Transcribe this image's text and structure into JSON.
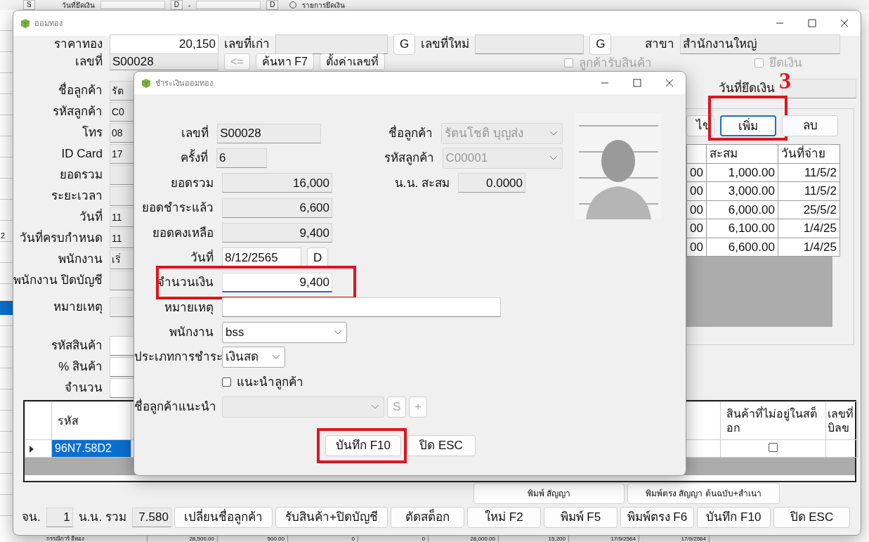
{
  "background_window": {
    "top_bar": {
      "s_button": "S",
      "date_label": "วันที่ยึดเงิน",
      "d_buttons": [
        "D",
        "D"
      ],
      "separator": "-",
      "radio": {
        "label": "รายการยึดเงิน",
        "selected": false
      }
    },
    "left_fragment": "2",
    "bottom_row": [
      "กรรณิการ์ อีทอง",
      "28,500.00",
      "500.00",
      "0",
      "0",
      "28,000.00",
      "15,200",
      "17/9/2564",
      "17/9/2564"
    ]
  },
  "main_window": {
    "title": "ออมทอง",
    "top_row": {
      "gold_price": {
        "label": "ราคาทอง",
        "value": "20,150"
      },
      "old_number": {
        "label": "เลขที่เก่า",
        "button": "G"
      },
      "new_number": {
        "label": "เลขที่ใหม่",
        "button": "G"
      },
      "branch": {
        "label": "สาขา",
        "value": "สำนักงานใหญ่"
      }
    },
    "number_row": {
      "label": "เลขที่",
      "value": "S00028",
      "buttons": [
        {
          "label": "<=",
          "disabled": true
        },
        {
          "label": "ค้นหา F7",
          "disabled": false
        },
        {
          "label": "ตั้งค่าเลขที่",
          "disabled": false
        }
      ],
      "checkboxes": [
        {
          "label": "ลูกค้ารับสินค้า",
          "checked": false,
          "disabled": true
        },
        {
          "label": "ยึดเงิน",
          "checked": false,
          "disabled": true
        }
      ]
    },
    "form_fields": [
      {
        "label": "ชื่อลูกค้า",
        "value": "รัต"
      },
      {
        "label": "รหัสลูกค้า",
        "value": "C0"
      },
      {
        "label": "โทร",
        "value": "08"
      },
      {
        "label": "ID Card",
        "value": "17"
      },
      {
        "label": "ยอดรวม"
      },
      {
        "label": "ระยะเวลา"
      },
      {
        "label": "วันที่",
        "value": "11"
      },
      {
        "label": "วันที่ครบกำหนด",
        "value": "11"
      },
      {
        "label": "พนักงาน",
        "value": "เริ่"
      },
      {
        "label": "พนักงาน ปิดบัญชี"
      },
      {
        "label": "หมายเหตุ"
      }
    ],
    "product_fields": [
      {
        "label": "รหัสสินค้า"
      },
      {
        "label": "% สินค้า"
      },
      {
        "label": "จำนวน"
      }
    ],
    "seize_date": {
      "label": "วันที่ยึดเงิน"
    },
    "step_number": "3",
    "payment_buttons": [
      {
        "label": "ไข",
        "focused": false,
        "highlighted": false
      },
      {
        "label": "เพิ่ม",
        "focused": true,
        "highlighted": true
      },
      {
        "label": "ลบ",
        "focused": false,
        "highlighted": false
      }
    ],
    "payment_table": {
      "columns": [
        "สะสม",
        "วันที่จ่าย"
      ],
      "rows": [
        {
          "column_1": "00",
          "accumulated": "1,000.00",
          "paid_date": "11/5/2"
        },
        {
          "column_1": "00",
          "accumulated": "3,000.00",
          "paid_date": "11/5/2"
        },
        {
          "column_1": "00",
          "accumulated": "6,000.00",
          "paid_date": "25/5/2"
        },
        {
          "column_1": "00",
          "accumulated": "6,100.00",
          "paid_date": "1/4/25"
        },
        {
          "column_1": "00",
          "accumulated": "6,600.00",
          "paid_date": "1/4/25"
        }
      ]
    },
    "product_grid": {
      "columns": [
        "รหัส",
        "สินค้าที่ไม่อยู่ในสต็อก",
        "เลขที่ บิลข"
      ],
      "rows": [
        {
          "code": "96N7.58D2",
          "selected": true,
          "not_in_stock": false
        }
      ]
    },
    "print_buttons": [
      "พิมพ์ สัญญา",
      "พิมพ์ตรง สัญญา ต้นฉบับ+สำเนา"
    ],
    "totals": {
      "count_label": "จน.",
      "count": "1",
      "weight_label": "น.น. รวม",
      "weight": "7.580"
    },
    "action_buttons": [
      "เปลี่ยนชื่อลูกค้า",
      "รับสินค้า+ปิดบัญชี",
      "ตัดสต็อก",
      "ใหม่ F2",
      "พิมพ์ F5",
      "พิมพ์ตรง F6",
      "บันทึก F10",
      "ปิด ESC"
    ]
  },
  "payment_dialog": {
    "title": "ชำระเงินออมทอง",
    "fields": [
      {
        "label": "เลขที่",
        "value": "S00028",
        "kind": "readonly"
      },
      {
        "label": "ครั้งที่",
        "value": "6",
        "kind": "short"
      },
      {
        "label": "ยอดรวม",
        "value": "16,000",
        "kind": "number"
      },
      {
        "label": "ยอดชำระแล้ว",
        "value": "6,600",
        "kind": "number"
      },
      {
        "label": "ยอดคงเหลือ",
        "value": "9,400",
        "kind": "number"
      },
      {
        "label": "วันที่",
        "value": "8/12/2565",
        "kind": "date",
        "button": "D"
      },
      {
        "label": "จำนวนเงิน",
        "value": "9,400",
        "kind": "amount",
        "highlighted": true
      },
      {
        "label": "หมายเหตุ",
        "kind": "text"
      },
      {
        "label": "พนักงาน",
        "value": "bss",
        "kind": "select"
      },
      {
        "label": "ประเภทการชำระ",
        "value": "เงินสด",
        "kind": "select_short"
      },
      {
        "label": "แนะนำลูกค้า",
        "kind": "checkbox",
        "checked": false
      },
      {
        "label": "ชื่อลูกค้าแนะนำ",
        "kind": "select_disabled",
        "buttons": [
          "S",
          "+"
        ]
      }
    ],
    "side_fields": [
      {
        "label": "ชื่อลูกค้า",
        "value": "รัตนโชติ บุญส่ง",
        "kind": "select_disabled"
      },
      {
        "label": "รหัสลูกค้า",
        "value": "C00001",
        "kind": "select_disabled"
      },
      {
        "label": "น.น. สะสม",
        "value": "0.0000",
        "kind": "number"
      }
    ],
    "buttons": [
      {
        "label": "บันทึก F10",
        "highlighted": true
      },
      {
        "label": "ปิด ESC",
        "highlighted": false
      }
    ]
  }
}
